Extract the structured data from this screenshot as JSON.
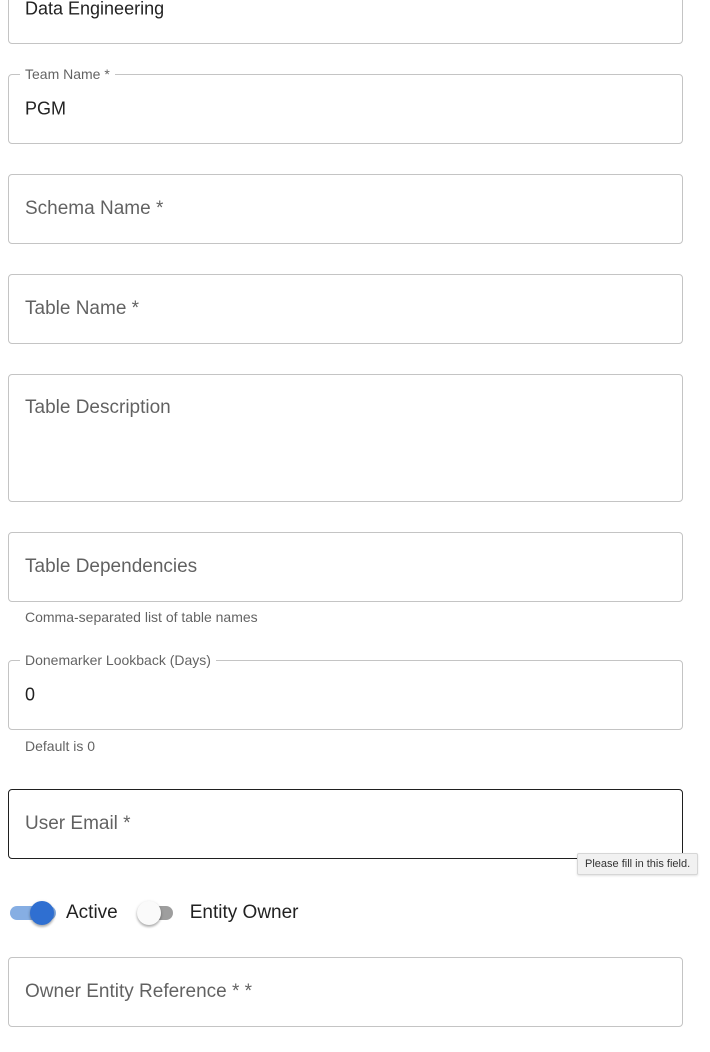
{
  "form": {
    "department": {
      "value": "Data Engineering"
    },
    "team_name": {
      "label": "Team Name *",
      "value": "PGM"
    },
    "schema_name": {
      "placeholder": "Schema Name *"
    },
    "table_name": {
      "placeholder": "Table Name *"
    },
    "table_description": {
      "placeholder": "Table Description"
    },
    "table_dependencies": {
      "placeholder": "Table Dependencies",
      "helper": "Comma-separated list of table names"
    },
    "donemarker_lookback": {
      "label": "Donemarker Lookback (Days)",
      "value": "0",
      "helper": "Default is 0"
    },
    "user_email": {
      "placeholder": "User Email *",
      "tooltip": "Please fill in this field."
    },
    "switches": {
      "active": {
        "label": "Active",
        "checked": true
      },
      "entity_owner": {
        "label": "Entity Owner",
        "checked": false
      }
    },
    "owner_entity_reference": {
      "placeholder": "Owner Entity Reference * *"
    }
  },
  "colors": {
    "accent": "#2f6fd1",
    "accent_track": "#86aee3",
    "border": "#c4c4c4",
    "focused_border": "#1f1f1f"
  }
}
